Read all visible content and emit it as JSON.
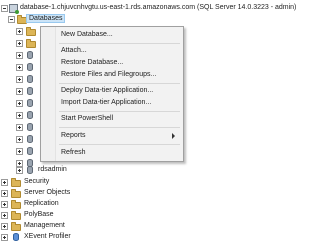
{
  "tree": {
    "server": "database-1.chjuvcnhvgtu.us-east-1.rds.amazonaws.com (SQL Server 14.0.3223 - admin)",
    "databases": "Databases",
    "rdsadmin": "rdsadmin",
    "nodes": [
      "Security",
      "Server Objects",
      "Replication",
      "PolyBase",
      "Management",
      "XEvent Profiler"
    ]
  },
  "menu": {
    "new_database": "New Database...",
    "attach": "Attach...",
    "restore_database": "Restore Database...",
    "restore_files": "Restore Files and Filegroups...",
    "deploy": "Deploy Data-tier Application...",
    "import": "Import Data-tier Application...",
    "powershell": "Start PowerShell",
    "reports": "Reports",
    "refresh": "Refresh"
  }
}
